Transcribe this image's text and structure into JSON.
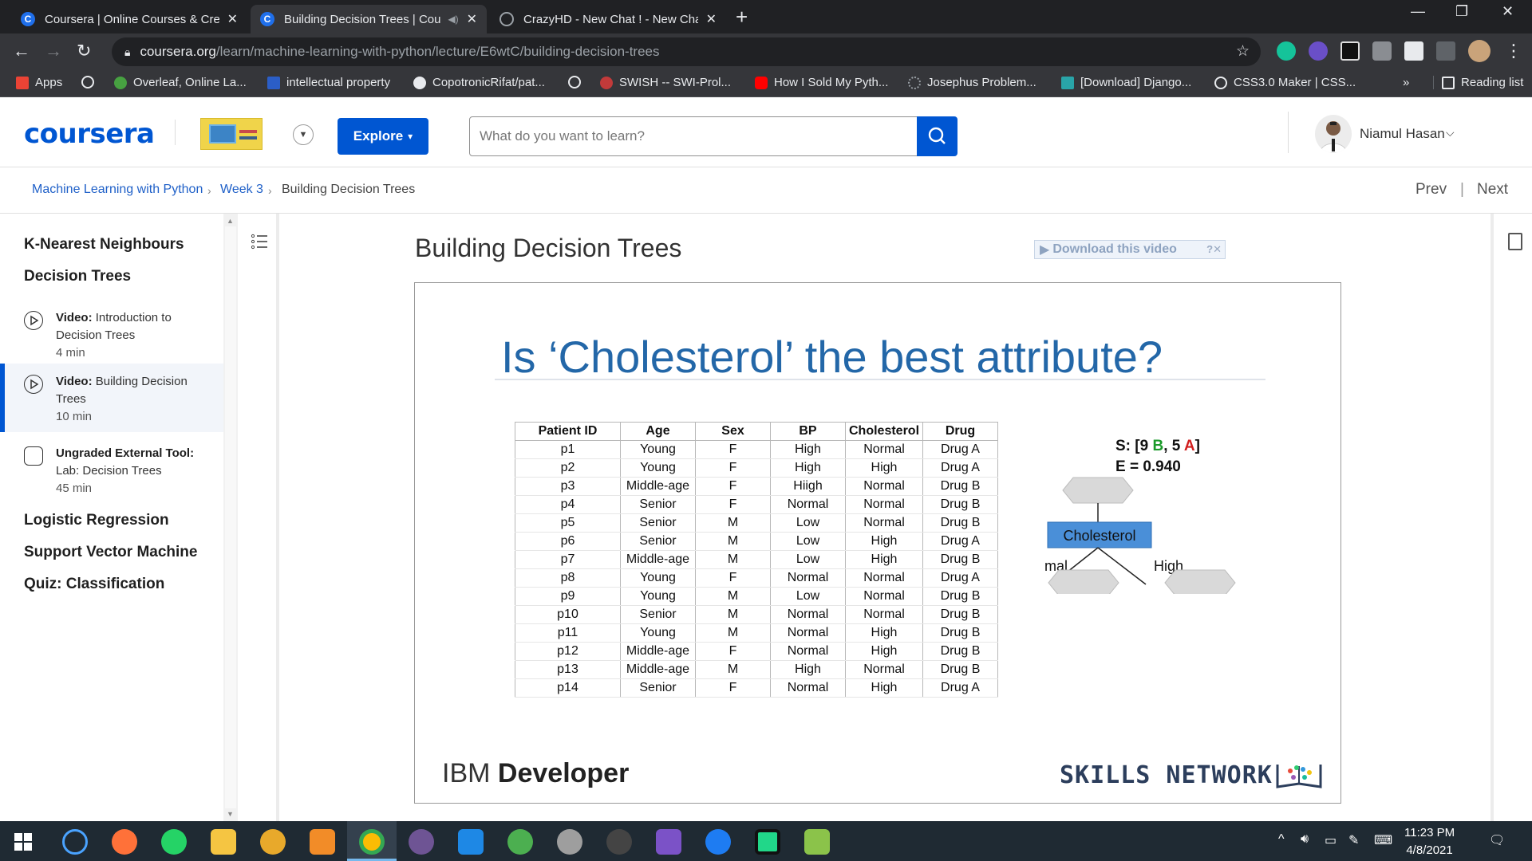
{
  "browser": {
    "tabs": [
      {
        "title": "Coursera | Online Courses & Cre",
        "favicon": "coursera-icon"
      },
      {
        "title": "Building Decision Trees | Cou",
        "favicon": "coursera-icon",
        "active": true
      },
      {
        "title": "CrazyHD - New Chat ! - New Cha",
        "favicon": "globe-icon"
      }
    ],
    "url_host": "coursera.org",
    "url_path": "/learn/machine-learning-with-python/lecture/E6wtC/building-decision-trees",
    "bookmarks": [
      "Apps",
      "Overleaf, Online La...",
      "intellectual property",
      "CopotronicRifat/pat...",
      "SWISH -- SWI-Prol...",
      "How I Sold My Pyth...",
      "Josephus Problem...",
      "[Download] Django...",
      "CSS3.0 Maker | CSS..."
    ],
    "bookmarks_more": "»",
    "reading_list": "Reading list"
  },
  "header": {
    "logo": "coursera",
    "explore": "Explore",
    "search_placeholder": "What do you want to learn?",
    "user_name": "Niamul Hasan"
  },
  "breadcrumb": {
    "course": "Machine Learning with Python",
    "week": "Week 3",
    "current": "Building Decision Trees",
    "prev": "Prev",
    "next": "Next"
  },
  "sidebar": {
    "sections": [
      {
        "title": "K-Nearest Neighbours"
      },
      {
        "title": "Decision Trees"
      },
      {
        "title": "Logistic Regression"
      },
      {
        "title": "Support Vector Machine"
      },
      {
        "title": "Quiz: Classification"
      }
    ],
    "items": [
      {
        "kind": "Video:",
        "name": "Introduction to Decision Trees",
        "duration": "4 min"
      },
      {
        "kind": "Video:",
        "name": "Building Decision Trees",
        "duration": "10 min",
        "selected": true
      },
      {
        "kind": "Ungraded External Tool:",
        "name": "Lab: Decision Trees",
        "duration": "45 min"
      }
    ]
  },
  "main": {
    "title": "Building Decision Trees",
    "download": "Download this video",
    "slide": {
      "title": "Is ‘Cholesterol’ the best attribute?",
      "columns": [
        "Patient ID",
        "Age",
        "Sex",
        "BP",
        "Cholesterol",
        "Drug"
      ],
      "rows": [
        [
          "p1",
          "Young",
          "F",
          "High",
          "Normal",
          "Drug A"
        ],
        [
          "p2",
          "Young",
          "F",
          "High",
          "High",
          "Drug A"
        ],
        [
          "p3",
          "Middle-age",
          "F",
          "Hiigh",
          "Normal",
          "Drug B"
        ],
        [
          "p4",
          "Senior",
          "F",
          "Normal",
          "Normal",
          "Drug B"
        ],
        [
          "p5",
          "Senior",
          "M",
          "Low",
          "Normal",
          "Drug B"
        ],
        [
          "p6",
          "Senior",
          "M",
          "Low",
          "High",
          "Drug A"
        ],
        [
          "p7",
          "Middle-age",
          "M",
          "Low",
          "High",
          "Drug B"
        ],
        [
          "p8",
          "Young",
          "F",
          "Normal",
          "Normal",
          "Drug A"
        ],
        [
          "p9",
          "Young",
          "M",
          "Low",
          "Normal",
          "Drug B"
        ],
        [
          "p10",
          "Senior",
          "M",
          "Normal",
          "Normal",
          "Drug B"
        ],
        [
          "p11",
          "Young",
          "M",
          "Normal",
          "High",
          "Drug B"
        ],
        [
          "p12",
          "Middle-age",
          "F",
          "Normal",
          "High",
          "Drug B"
        ],
        [
          "p13",
          "Middle-age",
          "M",
          "High",
          "Normal",
          "Drug B"
        ],
        [
          "p14",
          "Senior",
          "F",
          "Normal",
          "High",
          "Drug A"
        ]
      ],
      "tree": {
        "s_prefix": "S: [9 ",
        "b_label": "B",
        "s_mid": ", 5 ",
        "a_label": "A",
        "s_suffix": "]",
        "entropy": "E = 0.940",
        "node": "Cholesterol",
        "left_branch": "Normal",
        "right_branch": "High"
      },
      "footer_left_prefix": "IBM ",
      "footer_left_bold": "Developer",
      "footer_right": "SKILLS NETWORK"
    }
  },
  "taskbar": {
    "time": "11:23 PM",
    "date": "4/8/2021"
  },
  "colors": {
    "brand": "#0056d2",
    "slide_title": "#2367a8",
    "node_fill": "#4a8fd8"
  }
}
